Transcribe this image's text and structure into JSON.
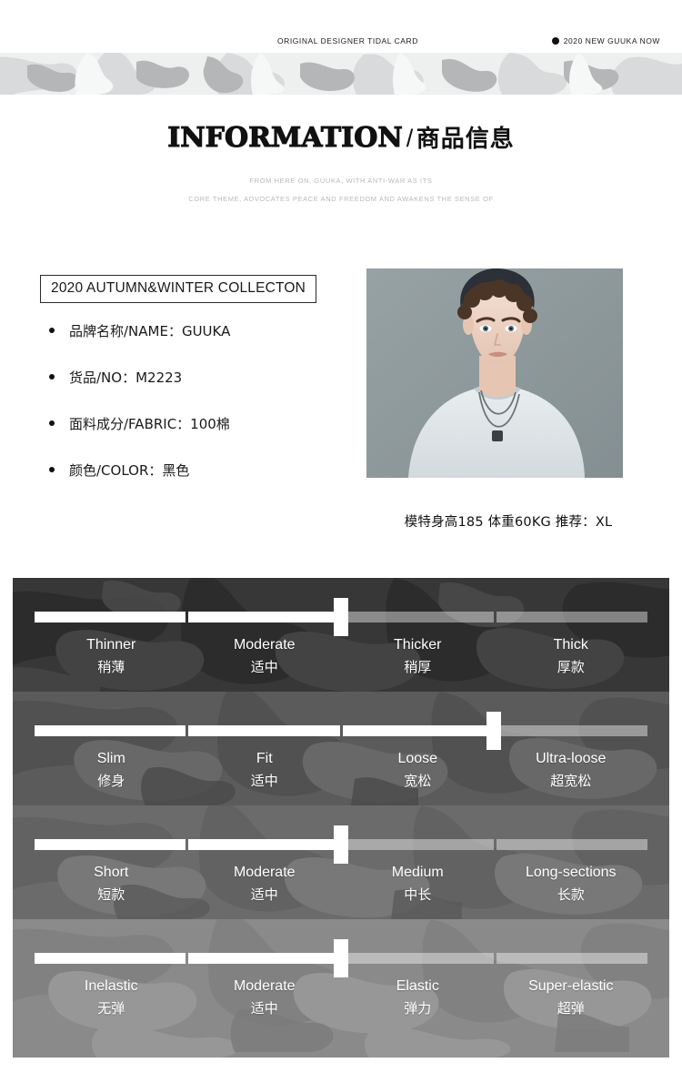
{
  "topbar": {
    "left_text": "ORIGINAL DESIGNER TIDAL CARD",
    "right_text": "2020 NEW GUUKA NOW",
    "dot_icon": "dot-icon"
  },
  "heading": {
    "english": "INFORMATION",
    "separator": "/",
    "chinese": "商品信息",
    "sub_line1": "FROM HERE ON, GUUKA, WITH ANTI-WAR AS ITS",
    "sub_line2": "CORE THEME, ADVOCATES PEACE AND FREEDOM AND AWAKENS THE SENSE OF"
  },
  "product": {
    "collection_label": "2020 AUTUMN&WINTER COLLECTON",
    "specs": [
      {
        "label": "品牌名称/NAME：GUUKA"
      },
      {
        "label": "货品/NO：M2223"
      },
      {
        "label": "面料成分/FABRIC：100棉"
      },
      {
        "label": "颜色/COLOR：黑色"
      }
    ],
    "photo_caption": "模特身高185 体重60KG  推荐：XL"
  },
  "sliders": [
    {
      "name": "thickness",
      "segments": 4,
      "filled": 2,
      "thumb_percent": 50,
      "options": [
        {
          "en": "Thinner",
          "cn": "稍薄"
        },
        {
          "en": "Moderate",
          "cn": "适中"
        },
        {
          "en": "Thicker",
          "cn": "稍厚"
        },
        {
          "en": "Thick",
          "cn": "厚款"
        }
      ]
    },
    {
      "name": "fit",
      "segments": 4,
      "filled": 3,
      "thumb_percent": 75,
      "options": [
        {
          "en": "Slim",
          "cn": "修身"
        },
        {
          "en": "Fit",
          "cn": "适中"
        },
        {
          "en": "Loose",
          "cn": "宽松"
        },
        {
          "en": "Ultra-loose",
          "cn": "超宽松"
        }
      ]
    },
    {
      "name": "length",
      "segments": 4,
      "filled": 2,
      "thumb_percent": 50,
      "options": [
        {
          "en": "Short",
          "cn": "短款"
        },
        {
          "en": "Moderate",
          "cn": "适中"
        },
        {
          "en": "Medium",
          "cn": "中长"
        },
        {
          "en": "Long-sections",
          "cn": "长款"
        }
      ]
    },
    {
      "name": "elasticity",
      "segments": 4,
      "filled": 2,
      "thumb_percent": 50,
      "options": [
        {
          "en": "Inelastic",
          "cn": "无弹"
        },
        {
          "en": "Moderate",
          "cn": "适中"
        },
        {
          "en": "Elastic",
          "cn": "弹力"
        },
        {
          "en": "Super-elastic",
          "cn": "超弹"
        }
      ]
    }
  ],
  "colors": {
    "row1_bg": "#3a3a3a",
    "row2_bg": "#5d5d5d",
    "row3_bg": "#6d6d6d",
    "row4_bg": "#8b8b8b",
    "photo_bg": "#8e9a9c",
    "accent": "#ffffff",
    "text": "#111111",
    "muted": "#b9b9b9"
  }
}
